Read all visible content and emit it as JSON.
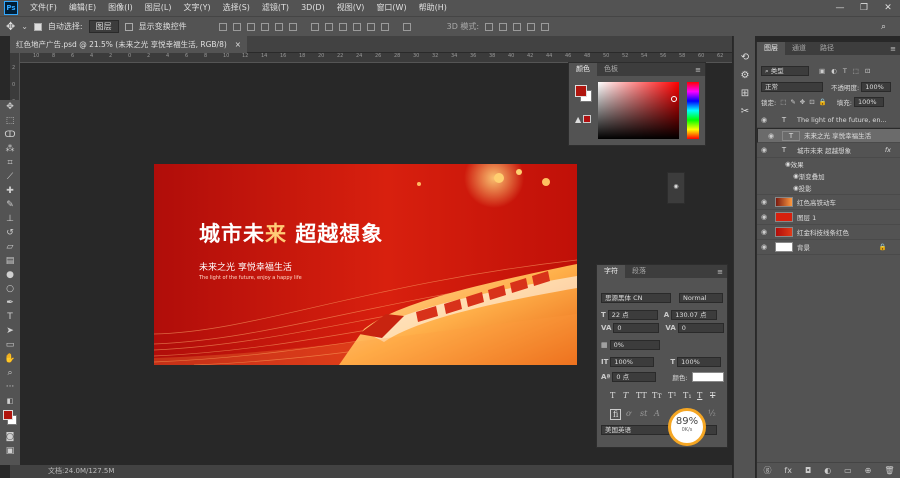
{
  "menubar": {
    "logo": "Ps",
    "items": [
      "文件(F)",
      "编辑(E)",
      "图像(I)",
      "图层(L)",
      "文字(Y)",
      "选择(S)",
      "滤镜(T)",
      "3D(D)",
      "视图(V)",
      "窗口(W)",
      "帮助(H)"
    ]
  },
  "options": {
    "auto_select_label": "自动选择:",
    "auto_select_value": "图层",
    "transform_label": "显示变换控件",
    "mode3d": "3D 模式:"
  },
  "document_tab": {
    "title": "红色地产广告.psd @ 21.5% (未来之光  享悦幸福生活, RGB/8)",
    "close": "×"
  },
  "rulers": {
    "h": [
      "12",
      "10",
      "8",
      "6",
      "4",
      "2",
      "0",
      "2",
      "4",
      "6",
      "8",
      "10",
      "12",
      "14",
      "16",
      "18",
      "20",
      "22",
      "24",
      "26",
      "28",
      "30",
      "32",
      "34",
      "36",
      "38",
      "40",
      "42",
      "44",
      "46",
      "48",
      "50",
      "52",
      "54",
      "56",
      "58",
      "60",
      "62"
    ],
    "v": [
      "2",
      "0",
      "2",
      "4",
      "6",
      "8",
      "1",
      "1",
      "1",
      "1",
      "2",
      "2",
      "2",
      "2",
      "2",
      "3",
      "3",
      "3",
      "3",
      "3",
      "4",
      "4",
      "4",
      "4"
    ]
  },
  "status": {
    "doc": "文档:24.0M/127.5M"
  },
  "banner": {
    "headline_white": "城市未",
    "headline_gold": "来",
    "headline_rest": " 超越想象",
    "sub": "未来之光  享悦幸福生活",
    "eng": "The light of the future, enjoy a happy life"
  },
  "color_panel": {
    "tab_color": "颜色",
    "tab_swatches": "色板",
    "fg": "#b0160f",
    "bg": "#ffffff"
  },
  "char_panel": {
    "tab_char": "字符",
    "tab_para": "段落",
    "font_family": "思源黑体 CN",
    "font_style": "Normal",
    "font_size": "22 点",
    "leading": "130.07 点",
    "kerning": "0",
    "tracking": "0",
    "tsume": "0%",
    "vscale": "100%",
    "hscale": "100%",
    "baseline": "0 点",
    "color_label": "颜色:",
    "language": "美国英语",
    "aa": "aa"
  },
  "perf": {
    "value": "89%",
    "speed": "0K/s"
  },
  "layers_panel": {
    "tabs": [
      "图层",
      "通道",
      "路径"
    ],
    "filter": "类型",
    "blend": "正常",
    "opacity_label": "不透明度:",
    "opacity": "100%",
    "lock_label": "锁定:",
    "fill_label": "填充:",
    "fill": "100%",
    "layers": [
      {
        "name": "The light of the future, en...",
        "type": "T"
      },
      {
        "name": "未来之光  享悦幸福生活",
        "type": "T"
      },
      {
        "name": "城市未来  超越想象",
        "type": "T",
        "fx": "fx"
      },
      {
        "name": "效果",
        "type": "effects"
      },
      {
        "name": "渐变叠加",
        "type": "effect"
      },
      {
        "name": "投影",
        "type": "effect"
      },
      {
        "name": "红色高铁动车",
        "type": "image"
      },
      {
        "name": "图层 1",
        "type": "image"
      },
      {
        "name": "红金科技线条红色",
        "type": "image"
      },
      {
        "name": "背景",
        "type": "bg"
      }
    ],
    "footer": [
      "ⓖ",
      "fx",
      "◘",
      "◐",
      "▭",
      "⊕",
      "🗑"
    ]
  }
}
